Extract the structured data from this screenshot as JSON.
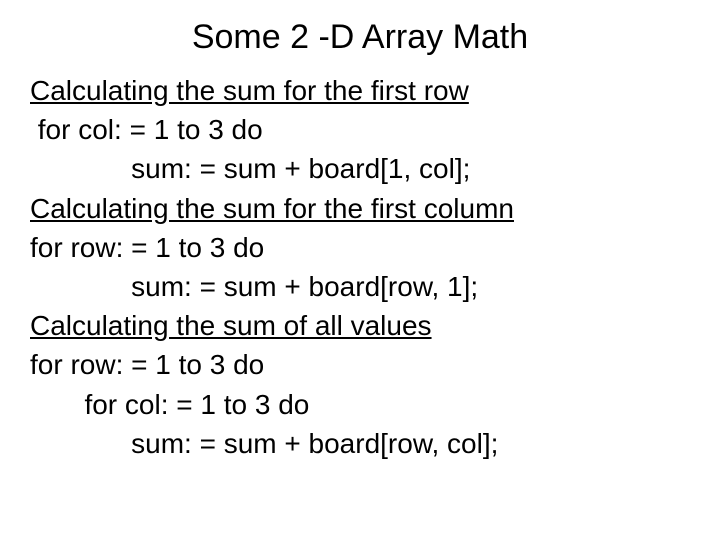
{
  "title": "Some 2 -D Array Math",
  "lines": {
    "h1": "Calculating the sum for the first row",
    "l1": " for col: = 1 to 3 do",
    "l2": "             sum: = sum + board[1, col];",
    "h2": "Calculating the sum for the first column",
    "l3": "for row: = 1 to 3 do",
    "l4": "             sum: = sum + board[row, 1];",
    "h3": "Calculating the sum of all values",
    "l5": "for row: = 1 to 3 do",
    "l6": "       for col: = 1 to 3 do",
    "l7": "             sum: = sum + board[row, col];"
  }
}
